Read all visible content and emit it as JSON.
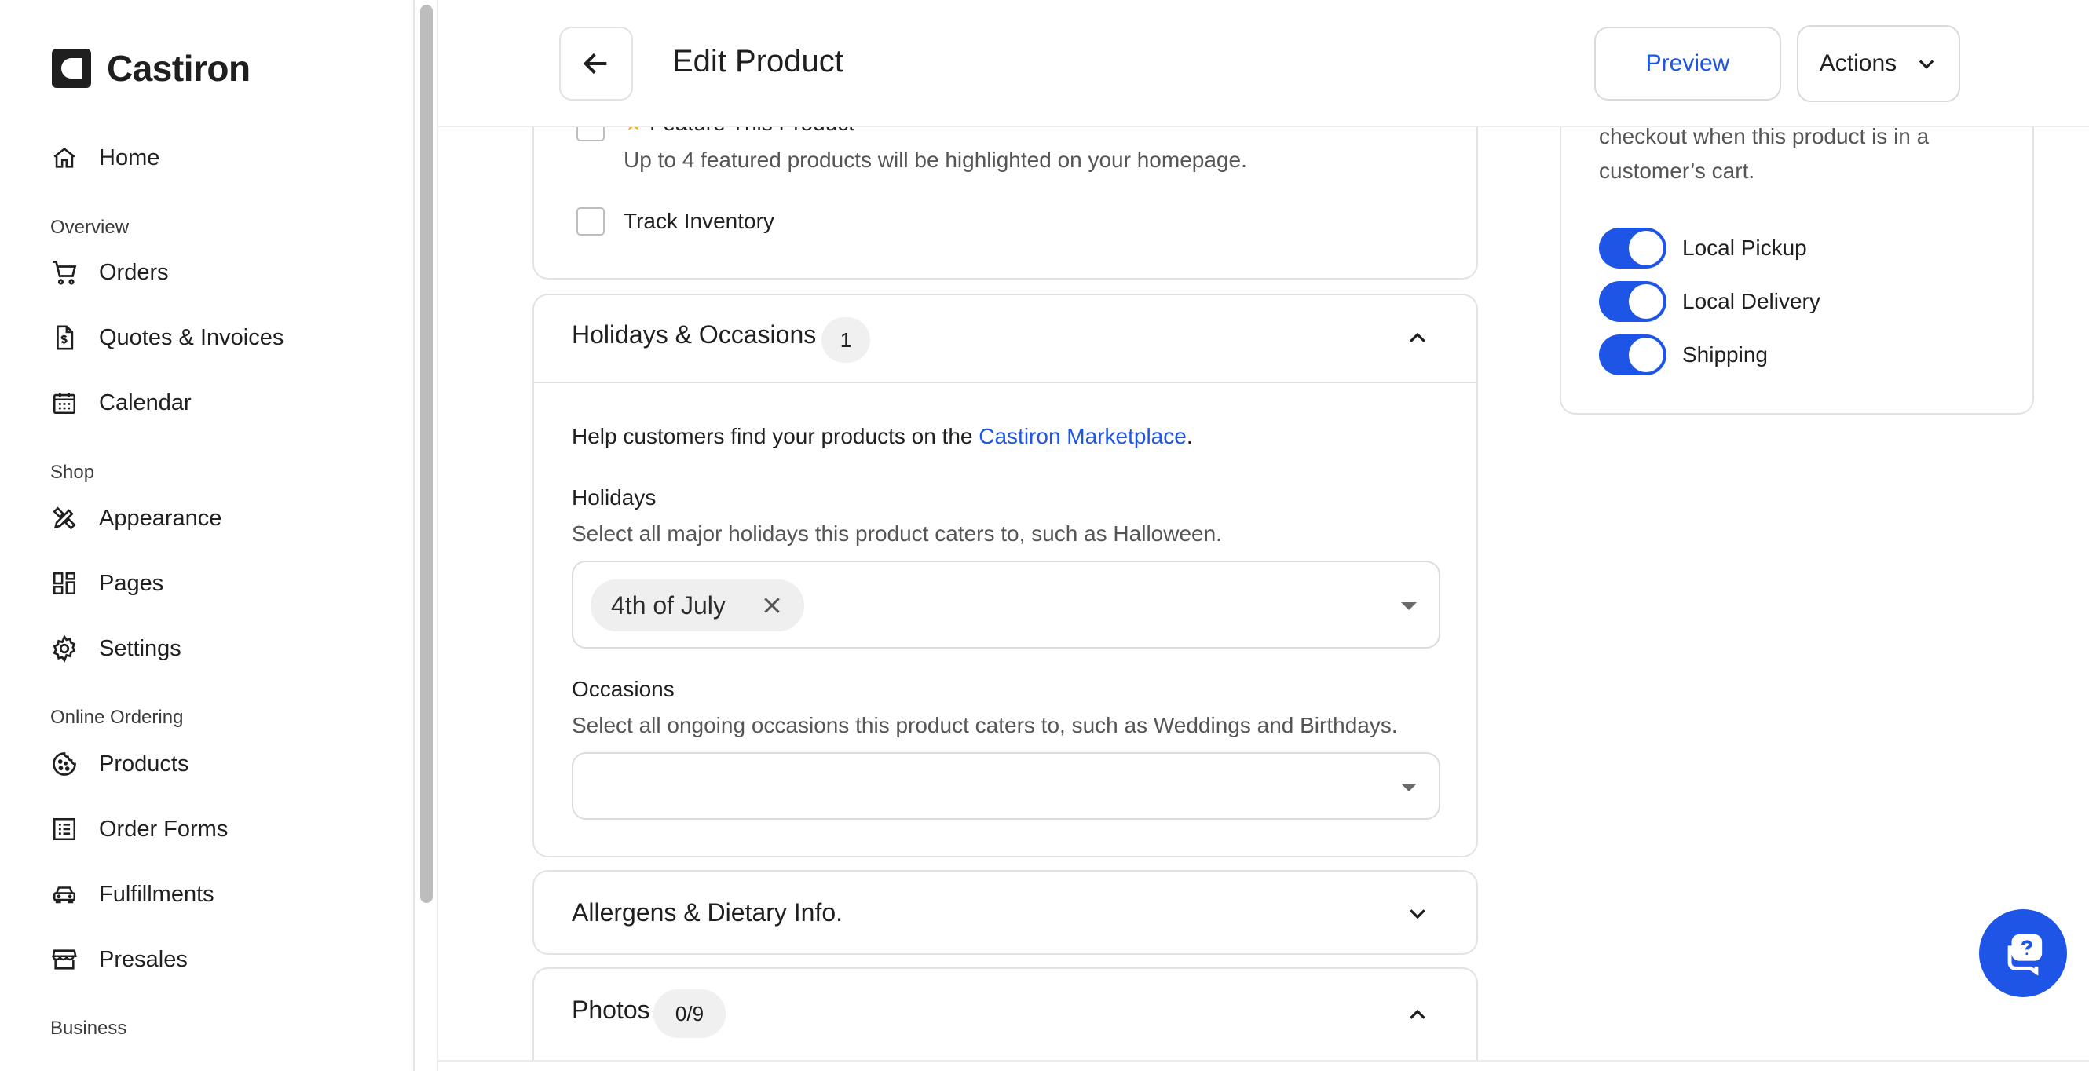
{
  "app": {
    "name": "Castiron"
  },
  "sidebar": {
    "home": "Home",
    "sections": {
      "overview": "Overview",
      "shop": "Shop",
      "online_ordering": "Online Ordering",
      "business": "Business"
    },
    "items": {
      "orders": "Orders",
      "quotes": "Quotes & Invoices",
      "calendar": "Calendar",
      "appearance": "Appearance",
      "pages": "Pages",
      "settings": "Settings",
      "products": "Products",
      "order_forms": "Order Forms",
      "fulfillments": "Fulfillments",
      "presales": "Presales"
    }
  },
  "header": {
    "title": "Edit Product",
    "preview_label": "Preview",
    "actions_label": "Actions"
  },
  "feature": {
    "label": "Feature This Product",
    "help": "Up to 4 featured products will be highlighted on your homepage.",
    "track_inventory": "Track Inventory"
  },
  "holidays_card": {
    "title": "Holidays & Occasions",
    "count": "1",
    "intro_prefix": "Help customers find your products on the ",
    "intro_link": "Castiron Marketplace",
    "intro_suffix": ".",
    "holidays_label": "Holidays",
    "holidays_help": "Select all major holidays this product caters to, such as Halloween.",
    "holidays_selected": [
      "4th of July"
    ],
    "occasions_label": "Occasions",
    "occasions_help": "Select all ongoing occasions this product caters to, such as Weddings and Birthdays."
  },
  "allergens_card": {
    "title": "Allergens & Dietary Info."
  },
  "photos_card": {
    "title": "Photos",
    "count": "0/9"
  },
  "fulfillment": {
    "note_line1": "checkout when this product is in a",
    "note_line2": "customer’s cart.",
    "toggles": [
      {
        "label": "Local Pickup",
        "on": true
      },
      {
        "label": "Local Delivery",
        "on": true
      },
      {
        "label": "Shipping",
        "on": true
      }
    ]
  },
  "colors": {
    "accent": "#1e55e6",
    "border": "#e2e2e2"
  }
}
